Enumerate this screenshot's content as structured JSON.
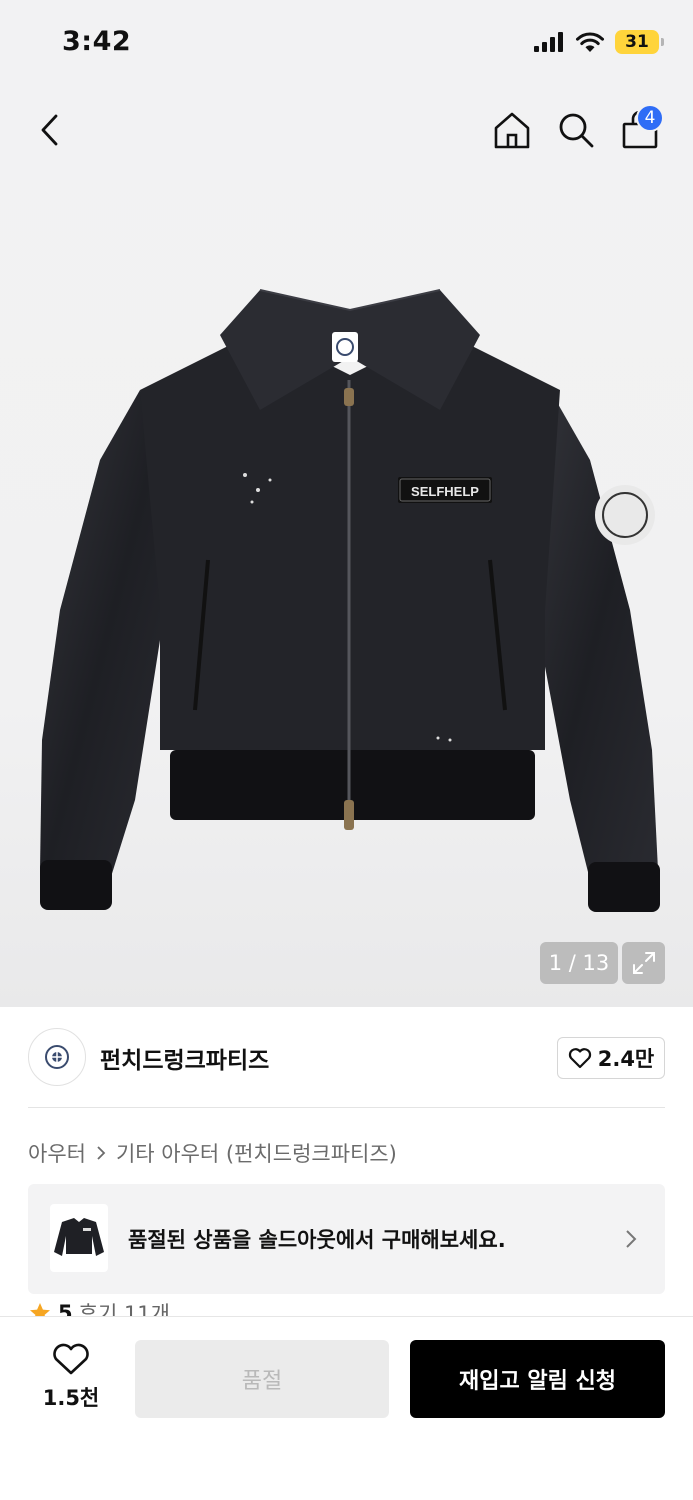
{
  "status_bar": {
    "time": "3:42",
    "battery": "31"
  },
  "nav": {
    "cart_badge": "4"
  },
  "gallery": {
    "counter": "1 / 13",
    "patch_text": "SELFHELP"
  },
  "brand": {
    "name": "펀치드렁크파티즈",
    "likes": "2.4만"
  },
  "breadcrumb": {
    "category": "아우터",
    "subcategory": "기타 아우터 (펀치드렁크파티즈)"
  },
  "soldout_banner": {
    "text": "품절된 상품을 솔드아웃에서 구매해보세요."
  },
  "review": {
    "score": "5",
    "label": "후기 11개"
  },
  "bottom": {
    "wish_count": "1.5천",
    "soldout_label": "품절",
    "restock_label": "재입고 알림 신청"
  },
  "colors": {
    "accent_blue": "#2f6df6",
    "battery_yellow": "#ffd43b",
    "star": "#f6a623",
    "primary_button": "#000000"
  }
}
